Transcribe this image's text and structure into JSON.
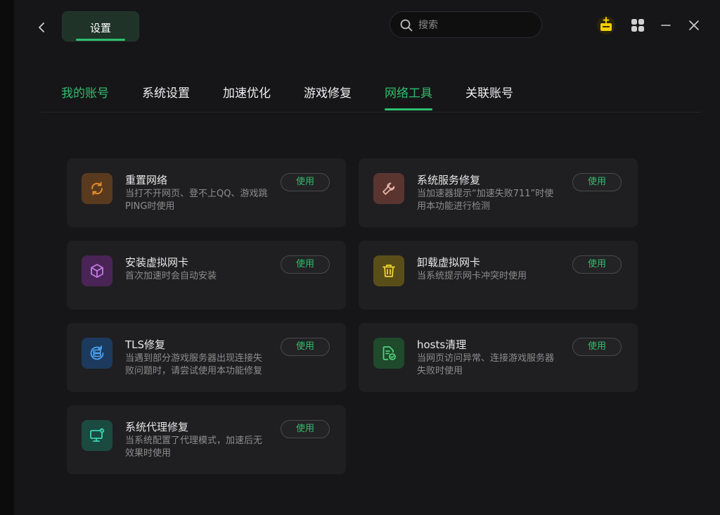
{
  "header": {
    "title_tab": "设置",
    "search_placeholder": "搜索"
  },
  "nav": {
    "tabs": [
      {
        "label": "我的账号"
      },
      {
        "label": "系统设置"
      },
      {
        "label": "加速优化"
      },
      {
        "label": "游戏修复"
      },
      {
        "label": "网络工具"
      },
      {
        "label": "关联账号"
      }
    ],
    "active_index": 4
  },
  "tools": [
    {
      "name": "重置网络",
      "desc": "当打不开网页、登不上QQ、游戏跳PING时使用",
      "button": "使用",
      "icon": "refresh-icon",
      "icon_color": "#e08a2e",
      "icon_bg": "#5a3a1e"
    },
    {
      "name": "系统服务修复",
      "desc": "当加速器提示“加速失败711”时使用本功能进行检测",
      "button": "使用",
      "icon": "wrench-icon",
      "icon_color": "#e6b0a6",
      "icon_bg": "#5a3530"
    },
    {
      "name": "安装虚拟网卡",
      "desc": "首次加速时会自动安装",
      "button": "使用",
      "icon": "cube-icon",
      "icon_color": "#c27ae6",
      "icon_bg": "#4a2456"
    },
    {
      "name": "卸载虚拟网卡",
      "desc": "当系统提示网卡冲突时使用",
      "button": "使用",
      "icon": "trash-icon",
      "icon_color": "#f0d233",
      "icon_bg": "#5a4e18"
    },
    {
      "name": "TLS修复",
      "desc": "当遇到部分游戏服务器出现连接失败问题时，请尝试使用本功能修复",
      "button": "使用",
      "icon": "server-refresh-icon",
      "icon_color": "#4aa3f0",
      "icon_bg": "#1c3a5e"
    },
    {
      "name": "hosts清理",
      "desc": "当网页访问异常、连接游戏服务器失败时使用",
      "button": "使用",
      "icon": "file-clean-icon",
      "icon_color": "#4fd17a",
      "icon_bg": "#1f4a2c"
    },
    {
      "name": "系统代理修复",
      "desc": "当系统配置了代理模式，加速后无效果时使用",
      "button": "使用",
      "icon": "monitor-icon",
      "icon_color": "#3ad6b0",
      "icon_bg": "#1a4a40"
    }
  ],
  "colors": {
    "accent": "#2fbf6e",
    "background": "#161618",
    "card": "#1f1f21",
    "gift": "#f5d000"
  }
}
